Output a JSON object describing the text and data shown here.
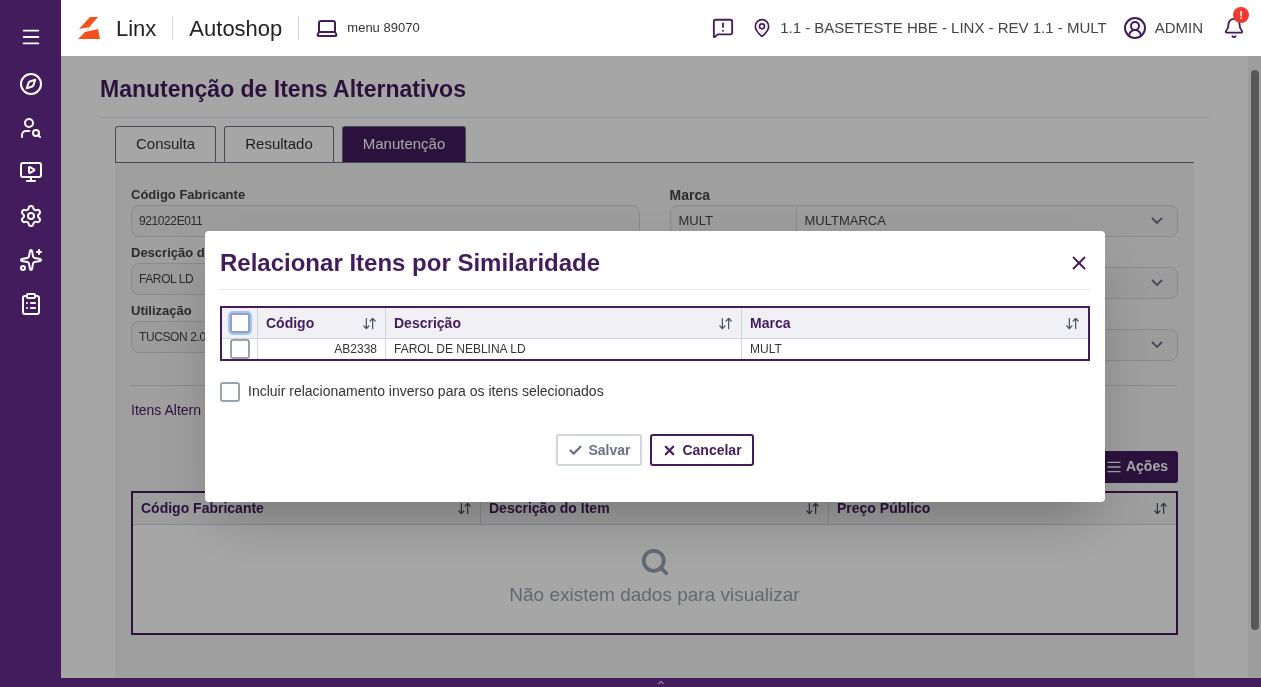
{
  "header": {
    "brand": "Linx",
    "app": "Autoshop",
    "menu": "menu 89070",
    "location": "1.1 - BASETESTE HBE - LINX - REV 1.1 - MULT",
    "user": "ADMIN",
    "notification_badge": "!"
  },
  "page": {
    "title": "Manutenção de Itens Alternativos",
    "tabs": [
      {
        "label": "Consulta",
        "selected": false
      },
      {
        "label": "Resultado",
        "selected": false
      },
      {
        "label": "Manutenção",
        "selected": true
      }
    ],
    "fields_left": [
      {
        "label": "Código Fabricante",
        "value": "921022E011"
      },
      {
        "label": "Descrição d",
        "value": "FAROL LD"
      },
      {
        "label": "Utilização",
        "value": "TUCSON 2.0"
      }
    ],
    "marca": {
      "label": "Marca",
      "code": "MULT",
      "name": "MULTMARCA"
    },
    "section_label": "Itens Altern",
    "actions_button": "Ações",
    "table": {
      "columns": [
        "Código Fabricante",
        "Descrição do Item",
        "Preço Público"
      ],
      "empty_message": "Não existem dados para visualizar"
    }
  },
  "dialog": {
    "title": "Relacionar Itens por Similaridade",
    "select_all": {
      "checked": false
    },
    "columns": [
      "Código",
      "Descrição",
      "Marca"
    ],
    "rows": [
      {
        "checked": false,
        "codigo": "AB2338",
        "descricao": "FAROL DE NEBLINA LD",
        "marca": "MULT"
      }
    ],
    "inverse_option": {
      "label": "Incluir relacionamento inverso para os itens selecionados",
      "checked": false
    },
    "buttons": [
      {
        "label": "Salvar",
        "kind": "secondary"
      },
      {
        "label": "Cancelar",
        "kind": "primary"
      }
    ]
  }
}
